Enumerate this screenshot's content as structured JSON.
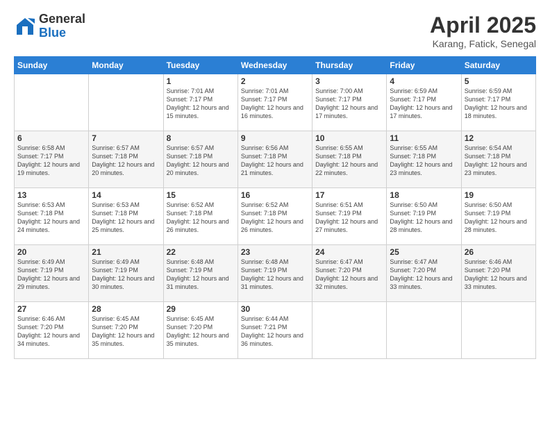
{
  "logo": {
    "general": "General",
    "blue": "Blue"
  },
  "title": {
    "month": "April 2025",
    "location": "Karang, Fatick, Senegal"
  },
  "weekdays": [
    "Sunday",
    "Monday",
    "Tuesday",
    "Wednesday",
    "Thursday",
    "Friday",
    "Saturday"
  ],
  "weeks": [
    [
      {
        "day": "",
        "info": ""
      },
      {
        "day": "",
        "info": ""
      },
      {
        "day": "1",
        "info": "Sunrise: 7:01 AM\nSunset: 7:17 PM\nDaylight: 12 hours and 15 minutes."
      },
      {
        "day": "2",
        "info": "Sunrise: 7:01 AM\nSunset: 7:17 PM\nDaylight: 12 hours and 16 minutes."
      },
      {
        "day": "3",
        "info": "Sunrise: 7:00 AM\nSunset: 7:17 PM\nDaylight: 12 hours and 17 minutes."
      },
      {
        "day": "4",
        "info": "Sunrise: 6:59 AM\nSunset: 7:17 PM\nDaylight: 12 hours and 17 minutes."
      },
      {
        "day": "5",
        "info": "Sunrise: 6:59 AM\nSunset: 7:17 PM\nDaylight: 12 hours and 18 minutes."
      }
    ],
    [
      {
        "day": "6",
        "info": "Sunrise: 6:58 AM\nSunset: 7:17 PM\nDaylight: 12 hours and 19 minutes."
      },
      {
        "day": "7",
        "info": "Sunrise: 6:57 AM\nSunset: 7:18 PM\nDaylight: 12 hours and 20 minutes."
      },
      {
        "day": "8",
        "info": "Sunrise: 6:57 AM\nSunset: 7:18 PM\nDaylight: 12 hours and 20 minutes."
      },
      {
        "day": "9",
        "info": "Sunrise: 6:56 AM\nSunset: 7:18 PM\nDaylight: 12 hours and 21 minutes."
      },
      {
        "day": "10",
        "info": "Sunrise: 6:55 AM\nSunset: 7:18 PM\nDaylight: 12 hours and 22 minutes."
      },
      {
        "day": "11",
        "info": "Sunrise: 6:55 AM\nSunset: 7:18 PM\nDaylight: 12 hours and 23 minutes."
      },
      {
        "day": "12",
        "info": "Sunrise: 6:54 AM\nSunset: 7:18 PM\nDaylight: 12 hours and 23 minutes."
      }
    ],
    [
      {
        "day": "13",
        "info": "Sunrise: 6:53 AM\nSunset: 7:18 PM\nDaylight: 12 hours and 24 minutes."
      },
      {
        "day": "14",
        "info": "Sunrise: 6:53 AM\nSunset: 7:18 PM\nDaylight: 12 hours and 25 minutes."
      },
      {
        "day": "15",
        "info": "Sunrise: 6:52 AM\nSunset: 7:18 PM\nDaylight: 12 hours and 26 minutes."
      },
      {
        "day": "16",
        "info": "Sunrise: 6:52 AM\nSunset: 7:18 PM\nDaylight: 12 hours and 26 minutes."
      },
      {
        "day": "17",
        "info": "Sunrise: 6:51 AM\nSunset: 7:19 PM\nDaylight: 12 hours and 27 minutes."
      },
      {
        "day": "18",
        "info": "Sunrise: 6:50 AM\nSunset: 7:19 PM\nDaylight: 12 hours and 28 minutes."
      },
      {
        "day": "19",
        "info": "Sunrise: 6:50 AM\nSunset: 7:19 PM\nDaylight: 12 hours and 28 minutes."
      }
    ],
    [
      {
        "day": "20",
        "info": "Sunrise: 6:49 AM\nSunset: 7:19 PM\nDaylight: 12 hours and 29 minutes."
      },
      {
        "day": "21",
        "info": "Sunrise: 6:49 AM\nSunset: 7:19 PM\nDaylight: 12 hours and 30 minutes."
      },
      {
        "day": "22",
        "info": "Sunrise: 6:48 AM\nSunset: 7:19 PM\nDaylight: 12 hours and 31 minutes."
      },
      {
        "day": "23",
        "info": "Sunrise: 6:48 AM\nSunset: 7:19 PM\nDaylight: 12 hours and 31 minutes."
      },
      {
        "day": "24",
        "info": "Sunrise: 6:47 AM\nSunset: 7:20 PM\nDaylight: 12 hours and 32 minutes."
      },
      {
        "day": "25",
        "info": "Sunrise: 6:47 AM\nSunset: 7:20 PM\nDaylight: 12 hours and 33 minutes."
      },
      {
        "day": "26",
        "info": "Sunrise: 6:46 AM\nSunset: 7:20 PM\nDaylight: 12 hours and 33 minutes."
      }
    ],
    [
      {
        "day": "27",
        "info": "Sunrise: 6:46 AM\nSunset: 7:20 PM\nDaylight: 12 hours and 34 minutes."
      },
      {
        "day": "28",
        "info": "Sunrise: 6:45 AM\nSunset: 7:20 PM\nDaylight: 12 hours and 35 minutes."
      },
      {
        "day": "29",
        "info": "Sunrise: 6:45 AM\nSunset: 7:20 PM\nDaylight: 12 hours and 35 minutes."
      },
      {
        "day": "30",
        "info": "Sunrise: 6:44 AM\nSunset: 7:21 PM\nDaylight: 12 hours and 36 minutes."
      },
      {
        "day": "",
        "info": ""
      },
      {
        "day": "",
        "info": ""
      },
      {
        "day": "",
        "info": ""
      }
    ]
  ]
}
